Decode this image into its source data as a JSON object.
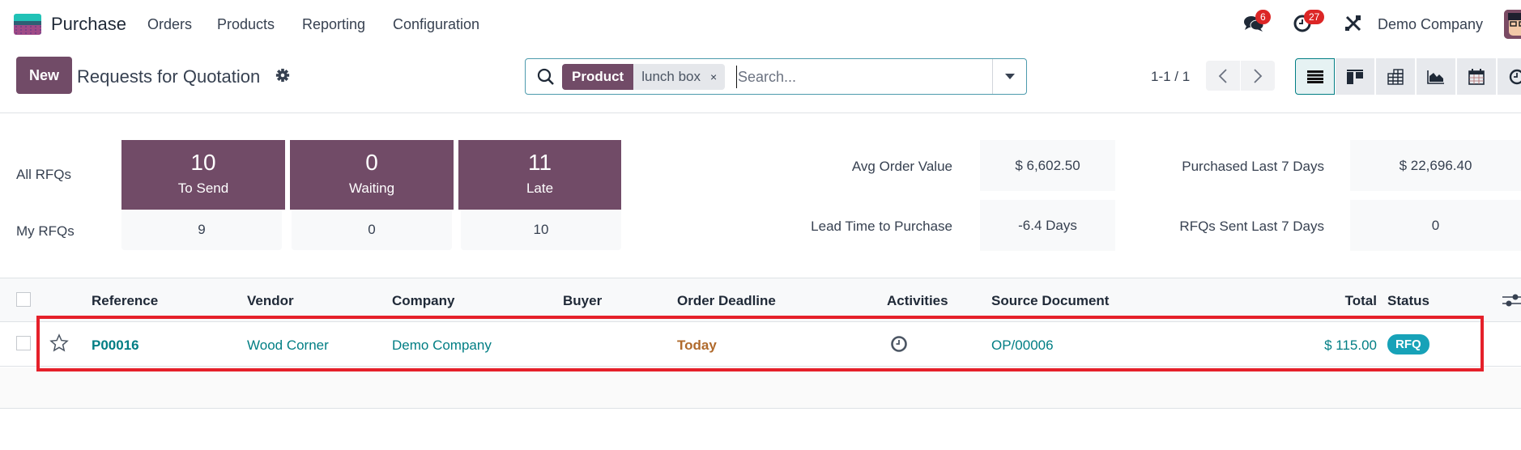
{
  "navbar": {
    "app_name": "Purchase",
    "menu": [
      "Orders",
      "Products",
      "Reporting",
      "Configuration"
    ],
    "messages_count": "6",
    "activities_count": "27",
    "company": "Demo Company"
  },
  "control_panel": {
    "new_label": "New",
    "title": "Requests for Quotation",
    "search": {
      "facet_label": "Product",
      "facet_value": "lunch box",
      "facet_remove": "×",
      "placeholder": "Search..."
    },
    "pager": "1-1 / 1",
    "views": [
      "list",
      "kanban",
      "pivot",
      "graph",
      "calendar",
      "activity"
    ],
    "active_view": "list"
  },
  "dashboard": {
    "row_labels": [
      "All RFQs",
      "My RFQs"
    ],
    "tiles": [
      {
        "count": "10",
        "label": "To Send",
        "mine": "9"
      },
      {
        "count": "0",
        "label": "Waiting",
        "mine": "0"
      },
      {
        "count": "11",
        "label": "Late",
        "mine": "10"
      }
    ],
    "metrics": [
      {
        "label": "Avg Order Value",
        "value": "$ 6,602.50"
      },
      {
        "label": "Lead Time to Purchase",
        "value": "-6.4 Days"
      },
      {
        "label": "Purchased Last 7 Days",
        "value": "$ 22,696.40"
      },
      {
        "label": "RFQs Sent Last 7 Days",
        "value": "0"
      }
    ]
  },
  "table": {
    "columns": [
      "Reference",
      "Vendor",
      "Company",
      "Buyer",
      "Order Deadline",
      "Activities",
      "Source Document",
      "Total",
      "Status"
    ],
    "rows": [
      {
        "reference": "P00016",
        "vendor": "Wood Corner",
        "company": "Demo Company",
        "buyer": "",
        "order_deadline": "Today",
        "activity": "clock-icon",
        "source_document": "OP/00006",
        "total": "$ 115.00",
        "status": "RFQ"
      }
    ]
  },
  "colors": {
    "brand": "#714b67",
    "link": "#017e84",
    "deadline_today": "#b06a2c",
    "status_rfq": "#17a2b8",
    "highlight": "#e5202a"
  }
}
